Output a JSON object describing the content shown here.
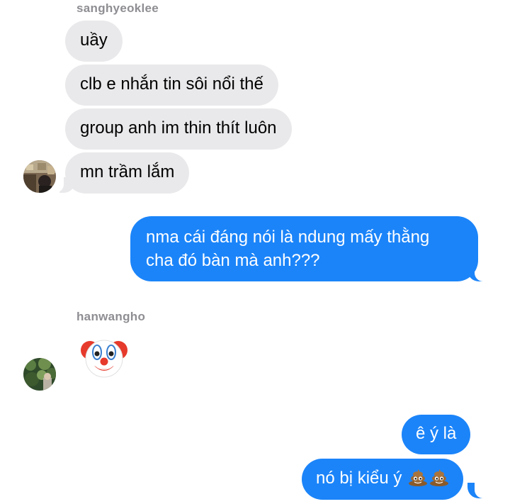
{
  "thread": {
    "sender_1": "sanghyeoklee",
    "sender_2": "hanwangho",
    "messages_1": [
      "uầy",
      "clb e nhắn tin sôi nổi thế",
      "group anh im thin thít luôn",
      "mn trầm lắm"
    ],
    "outgoing_1_line1": "nma cái đáng nói là ndung mấy thằng",
    "outgoing_1_line2": "cha đó bàn mà anh???",
    "emoji_message": "clown-face-emoji",
    "outgoing_2": "ê ý là",
    "outgoing_3_text": "nó bị kiểu ý",
    "outgoing_3_emoji": "pile-of-poo-emoji"
  },
  "colors": {
    "incoming_bubble": "#e9e9eb",
    "outgoing_bubble": "#1b84f9",
    "sender_name": "#8e8e93"
  }
}
